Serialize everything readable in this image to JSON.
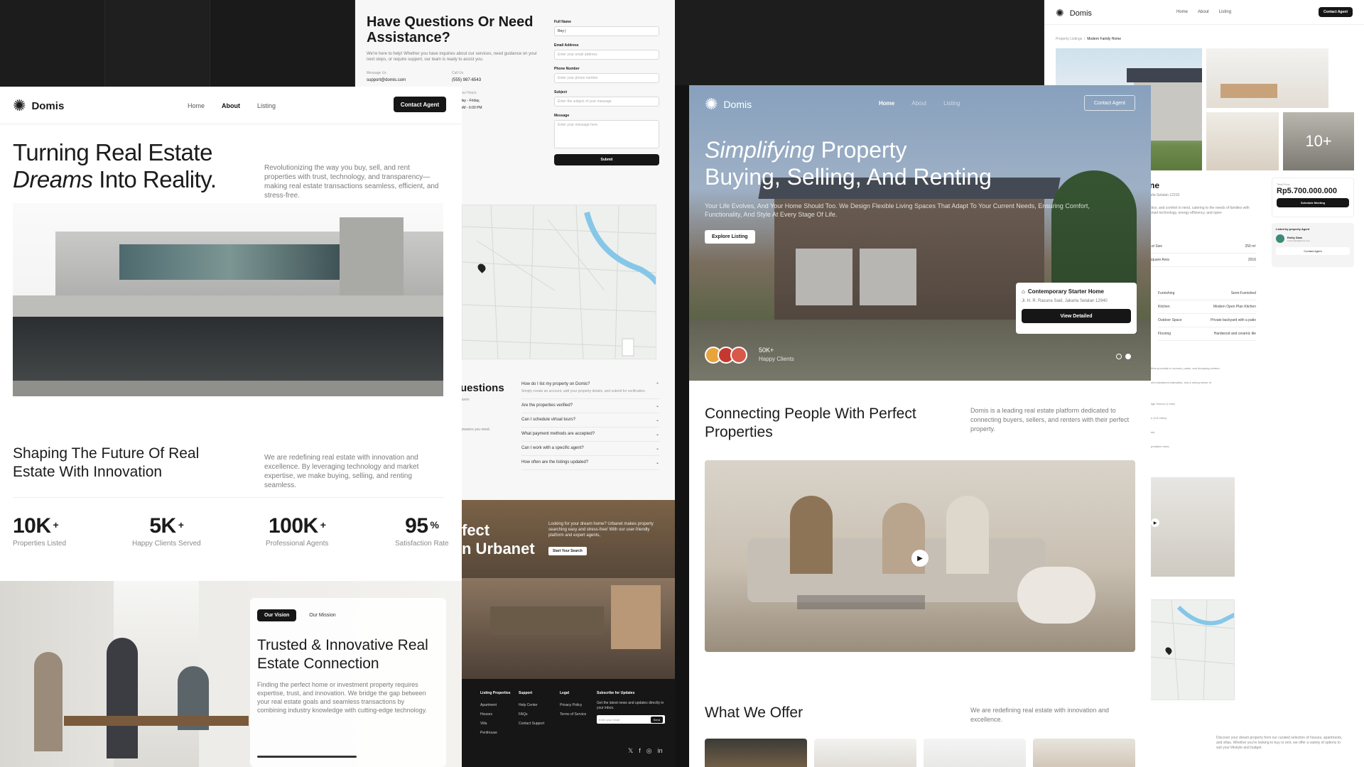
{
  "brand": {
    "name": "Domis"
  },
  "about_page": {
    "nav": [
      "Home",
      "About",
      "Listing"
    ],
    "contact_button": "Contact Agent",
    "hero_title_line1": "Turning Real Estate",
    "hero_title_italic": "Dreams",
    "hero_title_line2_rest": " Into Reality.",
    "hero_desc": "Revolutionizing the way you buy, sell, and rent properties with trust, technology, and transparency—making real estate transactions seamless, efficient, and stress-free.",
    "section_title": "Shaping The Future Of Real Estate With Innovation",
    "section_desc": "We are redefining real estate with innovation and excellence. By leveraging technology and market expertise, we make buying, selling, and renting seamless.",
    "stats": [
      {
        "value": "10K",
        "suffix": "+",
        "label": "Properties Listed"
      },
      {
        "value": "5K",
        "suffix": "+",
        "label": "Happy Clients Served"
      },
      {
        "value": "100K",
        "suffix": "+",
        "label": "Professional Agents"
      },
      {
        "value": "95",
        "suffix": "%",
        "label": "Satisfaction Rate"
      }
    ],
    "tabs": [
      "Our Vision",
      "Our Mission"
    ],
    "vision_title": "Trusted & Innovative Real Estate Connection",
    "vision_desc": "Finding the perfect home or investment property requires expertise, trust, and innovation. We bridge the gap between your real estate goals and seamless transactions by combining industry knowledge with cutting-edge technology."
  },
  "contact_page": {
    "title": "Have Questions Or Need Assistance?",
    "desc": "We're here to help! Whether you have inquiries about our services, need guidance on your next steps, or require support, our team is ready to assist you.",
    "message_us_label": "Message Us",
    "message_us_value": "support@domis.com",
    "call_us_label": "Call Us",
    "call_us_value": "(555) 987-6543",
    "hours_label": "ess Hours",
    "hours_value1": "day - Friday,",
    "hours_value2": "AM - 6:00 PM",
    "form": {
      "full_name_label": "Full Name",
      "full_name_value": "Rey |",
      "email_label": "Email Address",
      "email_placeholder": "Enter your email address",
      "phone_label": "Phone Number",
      "phone_placeholder": "Enter your phone number",
      "subject_label": "Subject",
      "subject_placeholder": "Enter the subject of your message",
      "message_label": "Message",
      "message_placeholder": "Enter your message here",
      "submit": "Submit"
    },
    "faq_title": "uestions",
    "faq_sub": "ncern",
    "faq_note": "answers you need.",
    "faqs": [
      {
        "q": "How do I list my property on Domis?",
        "a": "Simply create an account, add your property details, and submit for verification."
      },
      {
        "q": "Are the properties verified?"
      },
      {
        "q": "Can I schedule virtual tours?"
      },
      {
        "q": "What payment methods are accepted?"
      },
      {
        "q": "Can I work with a specific agent?"
      },
      {
        "q": "How often are the listings updated?"
      }
    ],
    "cta_title1": "fect",
    "cta_title2": "n Urbanet",
    "cta_desc": "Looking for your dream home? Urbanet makes property searching easy and stress-free! With our user-friendly platform and expert agents,",
    "cta_button": "Start Your Search",
    "footer": {
      "col1_title": "Listing Properties",
      "col1": [
        "Apartment",
        "Houses",
        "Villa",
        "Penthouse"
      ],
      "col2_title": "Support",
      "col2": [
        "Help Center",
        "FAQs",
        "Contact Support"
      ],
      "col3_title": "Legal",
      "col3": [
        "Privacy Policy",
        "Terms of Service"
      ],
      "col4_title": "Subscribe for Updates",
      "col4_desc": "Get the latest news and updates directly in your inbox.",
      "email_placeholder": "Enter your email",
      "send": "Send"
    }
  },
  "home_page": {
    "nav": [
      "Home",
      "About",
      "Listing"
    ],
    "contact_button": "Contact Agent",
    "hero_italic": "Simplifying",
    "hero_rest1": " Property",
    "hero_line2": "Buying, Selling, And Renting",
    "hero_desc": "Your Life Evolves, And Your Home Should Too. We Design Flexible Living Spaces That Adapt To Your Current Needs, Ensuring Comfort, Functionality, And Style At Every Stage Of Life.",
    "explore_button": "Explore Listing",
    "card_title": "Contemporary Starter Home",
    "card_address": "Jl. H. R. Rasuna Said, Jakarta Selatan 12940",
    "card_button": "View Detailed",
    "clients_count": "50K+",
    "clients_label": "Happy Clients",
    "connect_title": "Connecting People With Perfect Properties",
    "connect_desc": "Domis is a leading real estate platform dedicated to connecting buyers, sellers, and renters with their perfect property.",
    "offer_title": "What We Offer",
    "offer_desc": "We are redefining real estate with innovation and excellence."
  },
  "detail_page": {
    "nav": [
      "Home",
      "About",
      "Listing"
    ],
    "contact_button": "Contact Agent",
    "breadcrumb": [
      "Property Listings",
      "Modern Family Home"
    ],
    "more_photos": "10+",
    "title_partial": "ne",
    "address_partial": "arta Selatan 12310",
    "desc_partial": "ctice, and comfort in mind, catering to the needs of families with smart technology, energy efficiency, and open-",
    "total_price_label": "Total Price",
    "total_price": "Rp5.700.000.000",
    "schedule_button": "Schedule Meeting",
    "listed_by": "Listed by property Agent",
    "agent_name": "Emily Zaan",
    "agent_email": "emily.zaan@domis.com",
    "agent_button": "Contact Agent",
    "specs": [
      {
        "k": "Lot Size",
        "v": "250 m²"
      },
      {
        "k": "Square Area",
        "v": "2016"
      }
    ],
    "features": [
      {
        "k": "Furnishing",
        "v": "Semi-Furnished"
      },
      {
        "k": "Kitchen",
        "v": "Modern Open Plan Kitchen"
      },
      {
        "k": "Outdoor Space",
        "v": "Private backyard with a patio"
      },
      {
        "k": "Flooring",
        "v": "Hardwood and ceramic tile"
      }
    ],
    "notes": [
      "offers proximity to schools, parks, and shopping centers.",
      "well-maintained sidewalks, and a strong sense of",
      "High School (1 mile)",
      "ce (0.8 miles)",
      "iles)",
      "sportation hubs."
    ],
    "bottom_desc": "Discover your dream property from our curated selection of houses, apartments, and villas. Whether you're looking to buy or rent, we offer a variety of options to suit your lifestyle and budget."
  },
  "colors": {
    "dark": "#161616",
    "bg": "#131313",
    "accent_green": "#3d8a7a"
  }
}
